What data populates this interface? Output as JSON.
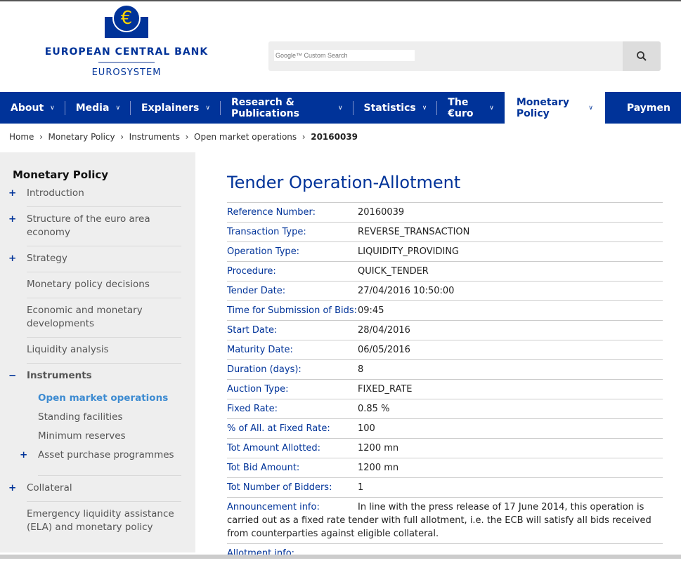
{
  "logo": {
    "symbol": "€",
    "name": "EUROPEAN CENTRAL BANK",
    "sub": "EUROSYSTEM"
  },
  "search": {
    "placeholder": "Google™ Custom Search",
    "icon": "search-icon"
  },
  "nav": [
    {
      "label": "About"
    },
    {
      "label": "Media"
    },
    {
      "label": "Explainers"
    },
    {
      "label": "Research & Publications"
    },
    {
      "label": "Statistics"
    },
    {
      "label": "The €uro"
    },
    {
      "label": "Monetary Policy",
      "active": true
    },
    {
      "label": "Paymen"
    }
  ],
  "breadcrumb": [
    "Home",
    "Monetary Policy",
    "Instruments",
    "Open market operations",
    "20160039"
  ],
  "sidebar": {
    "title": "Monetary Policy",
    "items": [
      "Introduction",
      "Structure of the euro area economy",
      "Strategy",
      "Monetary policy decisions",
      "Economic and monetary developments",
      "Liquidity analysis",
      "Instruments",
      "Collateral",
      "Emergency liquidity assistance (ELA) and monetary policy"
    ],
    "sub": [
      "Open market operations",
      "Standing facilities",
      "Minimum reserves",
      "Asset purchase programmes"
    ]
  },
  "main": {
    "title": "Tender Operation-Allotment",
    "rows": [
      [
        "Reference Number:",
        "20160039"
      ],
      [
        "Transaction Type:",
        "REVERSE_TRANSACTION"
      ],
      [
        "Operation Type:",
        "LIQUIDITY_PROVIDING"
      ],
      [
        "Procedure:",
        "QUICK_TENDER"
      ],
      [
        "Tender Date:",
        "27/04/2016 10:50:00"
      ],
      [
        "Time for Submission of Bids:",
        "09:45"
      ],
      [
        "Start Date:",
        "28/04/2016"
      ],
      [
        "Maturity Date:",
        "06/05/2016"
      ],
      [
        "Duration (days):",
        "8"
      ],
      [
        "Auction Type:",
        "FIXED_RATE"
      ],
      [
        "Fixed Rate:",
        "0.85 %"
      ],
      [
        "% of All. at Fixed Rate:",
        "100"
      ],
      [
        "Tot Amount Allotted:",
        "1200 mn"
      ],
      [
        "Tot Bid Amount:",
        "1200 mn"
      ],
      [
        "Tot Number of Bidders:",
        "1"
      ],
      [
        "Announcement info:",
        "In line with the press release of 17 June 2014, this operation is carried out as a fixed rate tender with full allotment, i.e. the ECB will satisfy all bids received from counterparties against eligible collateral."
      ],
      [
        "Allotment info:",
        ""
      ]
    ]
  }
}
